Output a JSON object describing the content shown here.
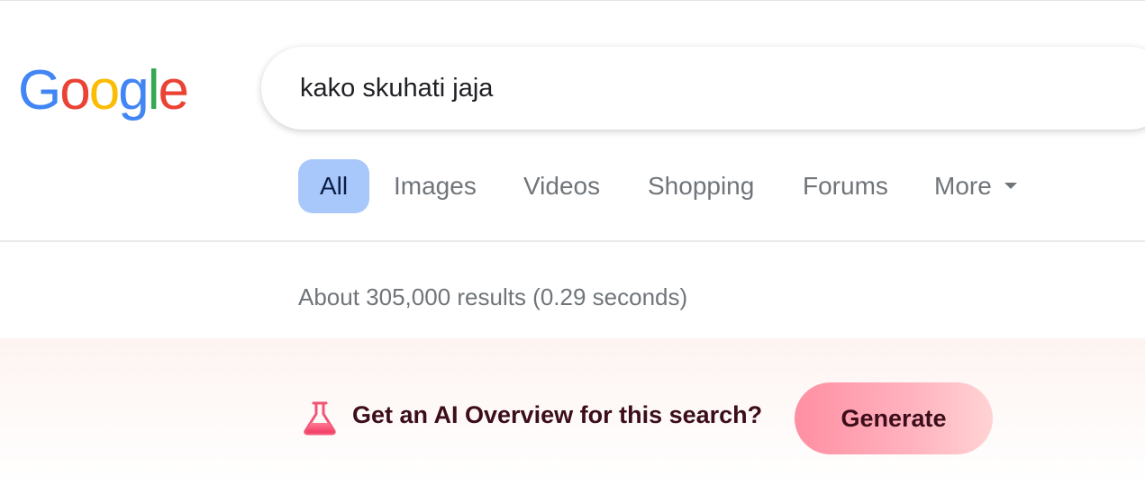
{
  "logo": {
    "letters": [
      "G",
      "o",
      "o",
      "g",
      "l",
      "e"
    ],
    "colors": [
      "#4285f4",
      "#ea4335",
      "#fbbc05",
      "#4285f4",
      "#34a853",
      "#ea4335"
    ]
  },
  "search": {
    "query": "kako skuhati jaja"
  },
  "tabs": [
    {
      "label": "All",
      "active": true
    },
    {
      "label": "Images",
      "active": false
    },
    {
      "label": "Videos",
      "active": false
    },
    {
      "label": "Shopping",
      "active": false
    },
    {
      "label": "Forums",
      "active": false
    },
    {
      "label": "More",
      "active": false,
      "icon": "caret-down-icon"
    }
  ],
  "results": {
    "stats": "About 305,000 results (0.29 seconds)"
  },
  "ai_overview": {
    "icon": "flask-icon",
    "prompt": "Get an AI Overview for this search?",
    "button_label": "Generate",
    "accent": "#ff8fa2"
  }
}
